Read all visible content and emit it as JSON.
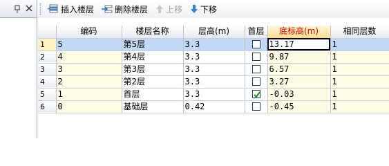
{
  "toolbar": {
    "insert_label": "插入楼层",
    "delete_label": "删除楼层",
    "up_label": "上移",
    "down_label": "下移"
  },
  "grid": {
    "headers": {
      "code": "编码",
      "name": "楼层名称",
      "height": "层高(m)",
      "first": "首层",
      "base": "底标高(m)",
      "same": "相同层数"
    },
    "rows": [
      {
        "num": "1",
        "code": "5",
        "name": "第5层",
        "height": "3.3",
        "first": false,
        "base": "13.17",
        "same": "1"
      },
      {
        "num": "2",
        "code": "4",
        "name": "第4层",
        "height": "3.3",
        "first": false,
        "base": "9.87",
        "same": "1"
      },
      {
        "num": "3",
        "code": "3",
        "name": "第3层",
        "height": "3.3",
        "first": false,
        "base": "6.57",
        "same": "1"
      },
      {
        "num": "4",
        "code": "2",
        "name": "第2层",
        "height": "3.3",
        "first": false,
        "base": "3.27",
        "same": "1"
      },
      {
        "num": "5",
        "code": "1",
        "name": "首层",
        "height": "3.3",
        "first": true,
        "base": "-0.03",
        "same": "1"
      },
      {
        "num": "6",
        "code": "0",
        "name": "基础层",
        "height": "0.42",
        "first": false,
        "base": "-0.45",
        "same": "1"
      }
    ]
  },
  "colors": {
    "selection": "#c1d9f6",
    "highlight_header": "#ffdc8e",
    "highlight_text": "#d40000",
    "input_cell": "#fffde8"
  }
}
